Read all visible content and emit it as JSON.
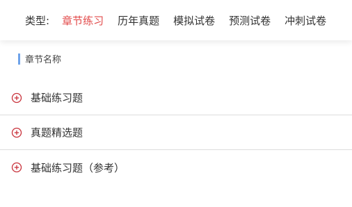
{
  "filter": {
    "label": "类型:",
    "tabs": [
      {
        "label": "章节练习",
        "active": true
      },
      {
        "label": "历年真题",
        "active": false
      },
      {
        "label": "模拟试卷",
        "active": false
      },
      {
        "label": "预测试卷",
        "active": false
      },
      {
        "label": "冲刺试卷",
        "active": false
      }
    ]
  },
  "section": {
    "title": "章节名称"
  },
  "chapters": [
    {
      "label": "基础练习题",
      "icon": "plus-circle-icon"
    },
    {
      "label": "真题精选题",
      "icon": "plus-circle-icon"
    },
    {
      "label": "基础练习题（参考）",
      "icon": "plus-circle-icon"
    }
  ],
  "colors": {
    "accent": "#e24a4a",
    "section_bar": "#6ea3ea",
    "icon": "#c8313a"
  }
}
